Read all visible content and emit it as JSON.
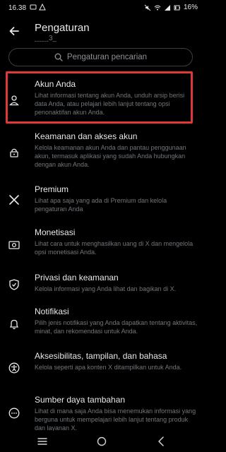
{
  "status": {
    "time": "16.38",
    "battery": "16%"
  },
  "header": {
    "title": "Pengaturan",
    "subtitle": "ˍˍˍˍˍˍ3_"
  },
  "search": {
    "placeholder": "Pengaturan pencarian"
  },
  "items": [
    {
      "title": "Akun Anda",
      "desc": "Lihat informasi tentang akun Anda, unduh arsip berisi data Anda, atau pelajari lebih lanjut tentang opsi penonaktifan akun Anda.",
      "icon": "person-icon"
    },
    {
      "title": "Keamanan dan akses akun",
      "desc": "Kelola keamanan akun Anda dan pantau penggunaan akun, termasuk aplikasi yang sudah Anda hubungkan dengan akun Anda.",
      "icon": "lock-icon"
    },
    {
      "title": "Premium",
      "desc": "Lihat apa saja yang ada di Premium dan kelola pengaturan Anda",
      "icon": "x-logo-icon"
    },
    {
      "title": "Monetisasi",
      "desc": "Lihat cara untuk menghasilkan uang di X dan mengelola opsi monetisasi Anda.",
      "icon": "money-icon"
    },
    {
      "title": "Privasi dan keamanan",
      "desc": "Kelola informasi yang Anda lihat dan bagikan di X.",
      "icon": "shield-icon"
    },
    {
      "title": "Notifikasi",
      "desc": "Pilih jenis notifikasi yang Anda dapatkan tentang aktivitas, minat, dan rekomendasi untuk Anda.",
      "icon": "bell-icon"
    },
    {
      "title": "Aksesibilitas, tampilan, dan bahasa",
      "desc": "Kelola seperti apa konten X ditampilkan untuk Anda.",
      "icon": "accessibility-icon"
    },
    {
      "title": "Sumber daya tambahan",
      "desc": "Lihat di mana saja Anda bisa menemukan informasi yang berguna untuk mempelajari lebih lanjut tentang produk dan layanan X.",
      "icon": "more-icon"
    }
  ],
  "colors": {
    "highlight": "#e0383a",
    "background": "#000000"
  }
}
